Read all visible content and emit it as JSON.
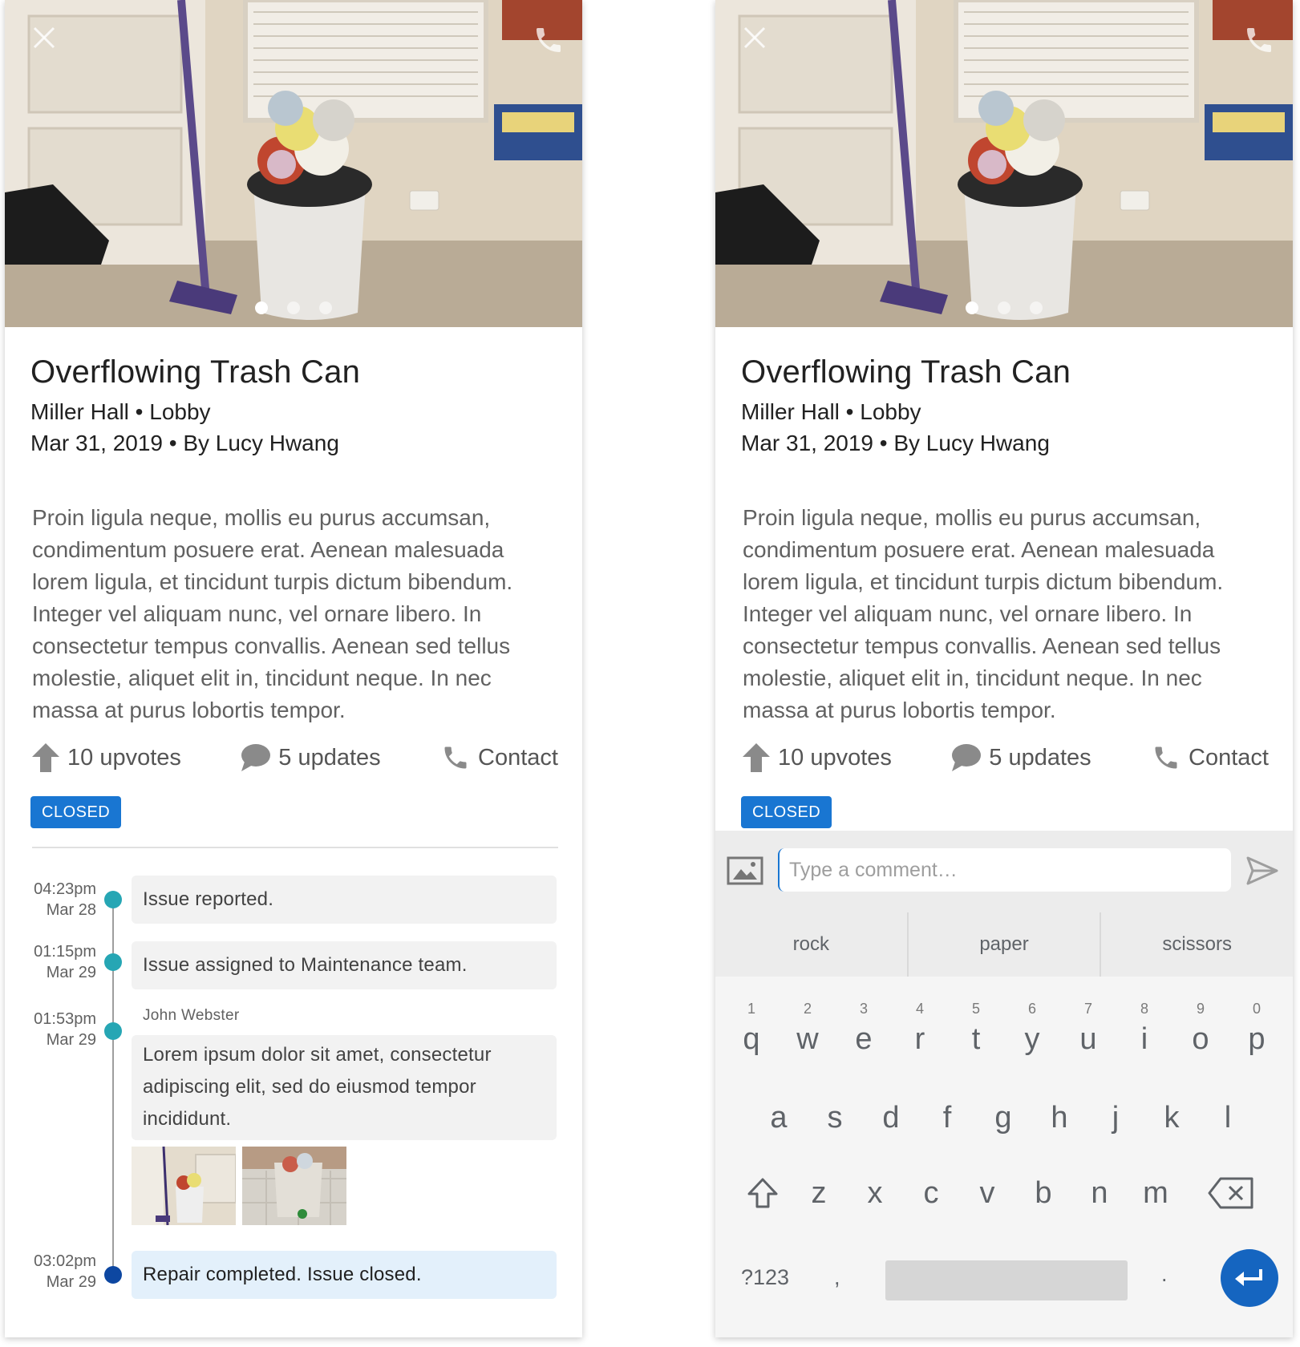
{
  "issue": {
    "title": "Overflowing Trash Can",
    "location": "Miller Hall • Lobby",
    "date_author": "Mar 31, 2019 • By Lucy Hwang",
    "description": "Proin ligula neque, mollis eu purus accumsan, condimentum posuere erat. Aenean malesuada lorem ligula, et tincidunt turpis dictum bibendum. Integer vel aliquam nunc, vel ornare libero. In consectetur tempus convallis. Aenean sed tellus molestie, aliquet elit in, tincidunt neque. In nec massa at purus lobortis tempor.",
    "status": "CLOSED",
    "photo_count": 3,
    "active_photo": 1
  },
  "actions": {
    "upvotes": "10 upvotes",
    "updates": "5 updates",
    "contact": "Contact"
  },
  "timeline": [
    {
      "time": "04:23pm",
      "date": "Mar 28",
      "text": "Issue reported."
    },
    {
      "time": "01:15pm",
      "date": "Mar 29",
      "text": "Issue assigned to Maintenance team."
    },
    {
      "time": "01:53pm",
      "date": "Mar 29",
      "author": "John Webster",
      "text": "Lorem ipsum dolor sit amet, consectetur adipiscing elit, sed do eiusmod tempor incididunt."
    },
    {
      "time": "03:02pm",
      "date": "Mar 29",
      "text": "Repair completed. Issue closed."
    }
  ],
  "comment": {
    "placeholder": "Type a comment…",
    "value": ""
  },
  "keyboard": {
    "suggestions": [
      "rock",
      "paper",
      "scissors"
    ],
    "row1": [
      "q",
      "w",
      "e",
      "r",
      "t",
      "y",
      "u",
      "i",
      "o",
      "p"
    ],
    "row1_hints": [
      "1",
      "2",
      "3",
      "4",
      "5",
      "6",
      "7",
      "8",
      "9",
      "0"
    ],
    "row2": [
      "a",
      "s",
      "d",
      "f",
      "g",
      "h",
      "j",
      "k",
      "l"
    ],
    "row3": [
      "z",
      "x",
      "c",
      "v",
      "b",
      "n",
      "m"
    ],
    "symbols_key": "?123",
    "comma_key": ",",
    "period_key": "."
  },
  "colors": {
    "accent": "#1976d2",
    "timeline_dot": "#26a6b4",
    "timeline_final_dot": "#0d47a1",
    "enter_key": "#1565c0"
  }
}
